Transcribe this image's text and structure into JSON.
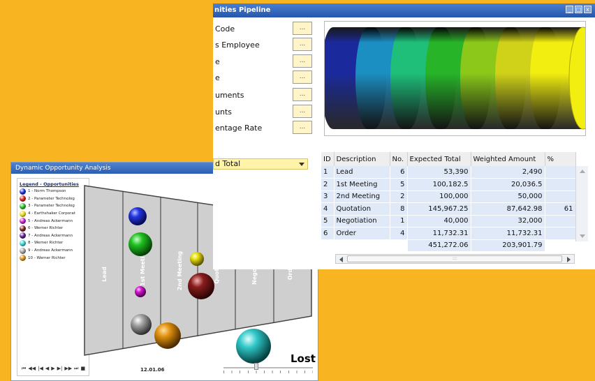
{
  "dynamic_window": {
    "title": "Dynamic Opportunity Analysis",
    "legend_title": "Legend - Opportunities",
    "legend": [
      {
        "label": "1 - Norm Thompson",
        "color": "#1a2dd6"
      },
      {
        "label": "2 - Parameter Technolog",
        "color": "#d11a1a"
      },
      {
        "label": "3 - Parameter Technolog",
        "color": "#22b522"
      },
      {
        "label": "4 - Earthshaker Corporat",
        "color": "#e0d80e"
      },
      {
        "label": "5 - Andreas Ackermann",
        "color": "#c41ac4"
      },
      {
        "label": "6 - Werner Richter",
        "color": "#7a1a1a"
      },
      {
        "label": "7 - Andreas Ackermann",
        "color": "#5a1a8a"
      },
      {
        "label": "8 - Werner Richter",
        "color": "#35c9c9"
      },
      {
        "label": "9 - Andreas Ackermann",
        "color": "#9a9a9a"
      },
      {
        "label": "10 - Werner Richter",
        "color": "#d4880e"
      }
    ],
    "stages": [
      "Lead",
      "1st Meeting",
      "2nd Meeting",
      "Quota",
      "Negoti",
      "Ord"
    ],
    "lost_label": "Lost",
    "nav_glyphs": [
      "⏮",
      "◀◀",
      "|◀",
      "◀",
      "▶",
      "▶|",
      "▶▶",
      "⏭",
      "■"
    ],
    "date": "12.01.06"
  },
  "pipeline_window": {
    "title": "nities Pipeline",
    "controls": [
      "_",
      "□",
      "x"
    ],
    "fields": [
      {
        "label": "Code",
        "button": "..."
      },
      {
        "label": "s Employee",
        "button": "..."
      },
      {
        "label": "e",
        "button": "..."
      },
      {
        "label": "e",
        "button": "..."
      },
      {
        "label": "uments",
        "button": "..."
      },
      {
        "label": "unts",
        "button": "..."
      },
      {
        "label": "entage Rate",
        "button": "..."
      }
    ],
    "dropdown_value": "d Total",
    "cylinder_colors": [
      "#1a2a9c",
      "#1c8fc2",
      "#1fbf7a",
      "#28b428",
      "#8cc81a",
      "#d0d21a",
      "#f2ee10"
    ],
    "table": {
      "headers": [
        "ID",
        "Description",
        "No.",
        "Expected Total",
        "Weighted Amount",
        "%"
      ],
      "rows": [
        [
          "1",
          "Lead",
          "6",
          "53,390",
          "2,490",
          ""
        ],
        [
          "2",
          "1st Meeting",
          "5",
          "100,182.5",
          "20,036.5",
          ""
        ],
        [
          "3",
          "2nd Meeting",
          "2",
          "100,000",
          "50,000",
          ""
        ],
        [
          "4",
          "Quotation",
          "8",
          "145,967.25",
          "87,642.98",
          "61"
        ],
        [
          "5",
          "Negotiation",
          "1",
          "40,000",
          "32,000",
          ""
        ],
        [
          "6",
          "Order",
          "4",
          "11,732.31",
          "11,732.31",
          ""
        ]
      ],
      "totals": {
        "expected": "451,272.06",
        "weighted": "203,901.79"
      }
    }
  }
}
